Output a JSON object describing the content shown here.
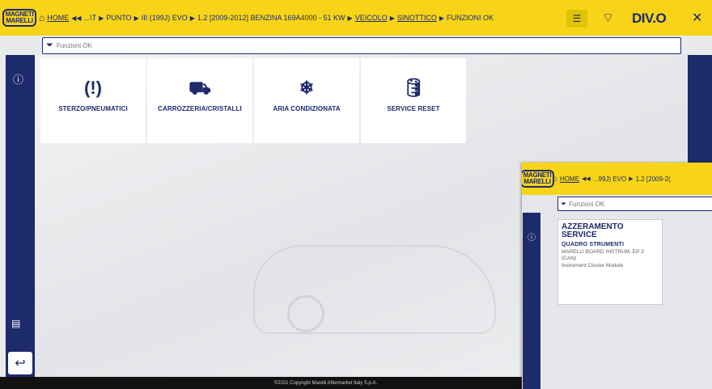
{
  "logo": {
    "line1": "MAGNETI",
    "line2": "MARELLI"
  },
  "breadcrumb": {
    "home": "HOME",
    "items": [
      {
        "sep": "◀◀",
        "text": "...\\T"
      },
      {
        "sep": "▶",
        "text": "PUNTO"
      },
      {
        "sep": "▶",
        "text": "III (199J) EVO"
      },
      {
        "sep": "▶",
        "text": "1.2 [2009-2012] BENZINA 169A4000 - 51 KW"
      },
      {
        "sep": "▶",
        "text": "VEICOLO"
      },
      {
        "sep": "▶",
        "text": "SINOTTICO"
      },
      {
        "sep": "▶",
        "text": "FUNZIONI OK"
      }
    ]
  },
  "header": {
    "brand": "DIV.O",
    "filter_icon": "sliders-icon",
    "wifi_icon": "wifi-icon",
    "close": "✕"
  },
  "search": {
    "placeholder": "Funzioni OK"
  },
  "tiles": [
    {
      "icon": "(!)",
      "label": "STERZO/PNEUMATICI"
    },
    {
      "icon": "⛟",
      "label": "CARROZZERIA/CRISTALLI"
    },
    {
      "icon": "❄",
      "label": "ARIA CONDIZIONATA"
    },
    {
      "icon": "🛢",
      "label": "SERVICE RESET"
    }
  ],
  "footer": {
    "text": "©2021 Copyright Marelli Aftermarket Italy S.p.A."
  },
  "overlay": {
    "breadcrumb": {
      "home": "HOME",
      "sep1": "◀◀",
      "crumb1": "...99J) EVO",
      "sep2": "▶",
      "crumb2": "1.2 [2009-2("
    },
    "search_placeholder": "Funzioni OK",
    "card": {
      "title": "AZZERAMENTO SERVICE",
      "subtitle": "QUADRO STRUMENTI",
      "detail": "MARELLI BOARD INSTRUM. EP 3 (CAN)",
      "module": "Instrument Cluster Module"
    }
  },
  "colors": {
    "accent": "#f7d417",
    "navy": "#1d2a6b"
  }
}
